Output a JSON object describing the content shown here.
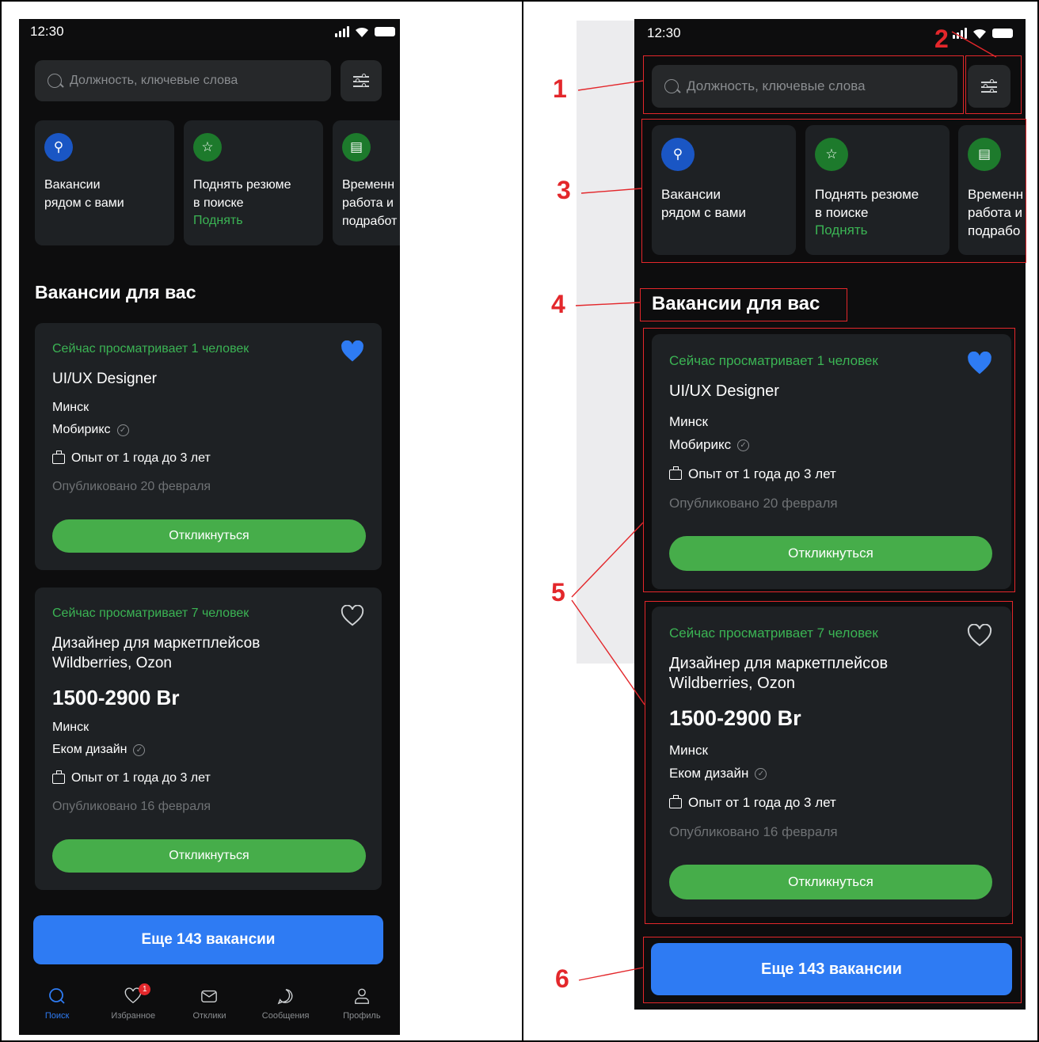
{
  "status": {
    "time": "12:30"
  },
  "search": {
    "placeholder": "Должность, ключевые слова"
  },
  "tiles": [
    {
      "title": "Вакансии\nрядом с вами",
      "action": "",
      "icon": "person-pin-icon",
      "color": "#1a56c4"
    },
    {
      "title": "Поднять резюме\nв поиске",
      "action": "Поднять",
      "icon": "star-icon",
      "color": "#1d7a2c"
    },
    {
      "title": "Временн\nработа и\nподрабо",
      "action": "",
      "icon": "document-check-icon",
      "color": "#1d7a2c"
    }
  ],
  "section_title": "Вакансии для вас",
  "vacancies": [
    {
      "live": "Сейчас просматривает 1 человек",
      "title": "UI/UX Designer",
      "salary": "",
      "city": "Минск",
      "company": "Мобирикс",
      "experience": "Опыт от 1 года до 3 лет",
      "published": "Опубликовано 20 февраля",
      "apply": "Откликнуться",
      "favorite": true
    },
    {
      "live": "Сейчас просматривает 7 человек",
      "title": "Дизайнер для маркетплейсов\nWildberries, Ozon",
      "salary": "1500-2900 Br",
      "city": "Минск",
      "company": "Еком дизайн",
      "experience": "Опыт от 1 года до 3 лет",
      "published": "Опубликовано 16 февраля",
      "apply": "Откликнуться",
      "favorite": false
    }
  ],
  "more_button": "Еще 143 вакансии",
  "tabs": [
    {
      "label": "Поиск",
      "icon": "search-icon",
      "active": true
    },
    {
      "label": "Избранное",
      "icon": "heart-icon",
      "badge": "1"
    },
    {
      "label": "Отклики",
      "icon": "mail-icon"
    },
    {
      "label": "Сообщения",
      "icon": "chat-icon"
    },
    {
      "label": "Профиль",
      "icon": "profile-icon"
    }
  ],
  "left_tile3_title": "Временн\nработа и\nподработ",
  "annotations": [
    "1",
    "2",
    "3",
    "4",
    "5",
    "6"
  ],
  "colors": {
    "accent_blue": "#2e7bf3",
    "accent_green": "#46ad4a",
    "annotation_red": "#e3272b"
  }
}
